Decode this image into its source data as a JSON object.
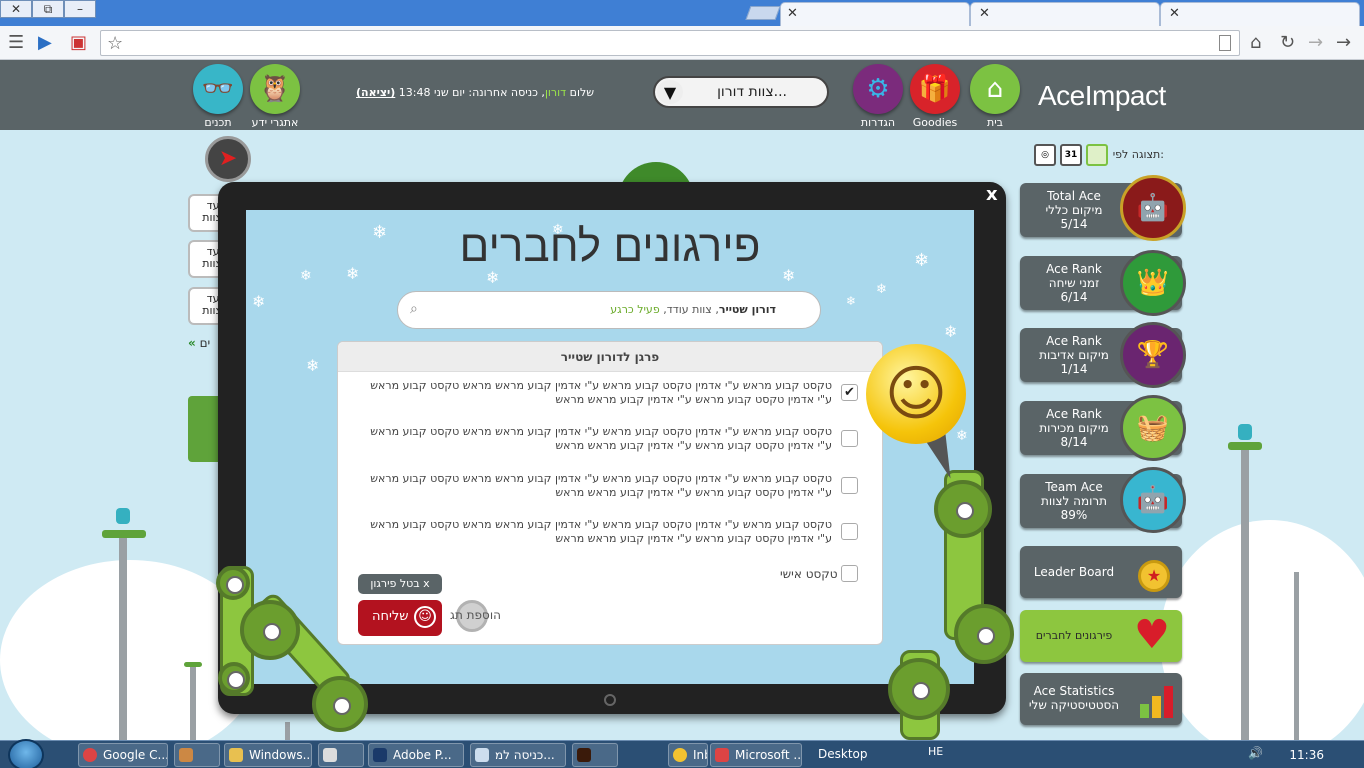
{
  "browser": {
    "window_buttons": [
      "✕",
      "⧉",
      "–"
    ],
    "tabs": [
      {
        "label": "",
        "close": "✕"
      },
      {
        "label": "",
        "close": "✕"
      },
      {
        "label": "",
        "close": "✕"
      }
    ]
  },
  "app": {
    "logo": "AceImpact",
    "nav": {
      "home": "בית",
      "goodies": "Goodies",
      "settings": "הגדרות",
      "challenges": "אתגרי ידע",
      "content": "תכנים"
    },
    "team_select": "צוות דורון...",
    "greeting": {
      "hello": "שלום",
      "user": "דורון",
      "last_login": ", כניסה אחרונה: יום שני 13:48",
      "exit": "(יציאה)"
    },
    "view_by": "תצוגה לפי:",
    "calendar_day": "31"
  },
  "sidebar": [
    {
      "line1": "Total Ace",
      "line2": "מיקום כללי",
      "line3": "5/14"
    },
    {
      "line1": "Ace Rank",
      "line2": "זמני שיחה",
      "line3": "6/14"
    },
    {
      "line1": "Ace Rank",
      "line2": "מיקום אדיבות",
      "line3": "1/14"
    },
    {
      "line1": "Ace Rank",
      "line2": "מיקום מכירות",
      "line3": "8/14"
    },
    {
      "line1": "Team Ace",
      "line2": "תרומה לצוות",
      "line3": "89%"
    },
    {
      "line1": "Leader Board"
    },
    {
      "line1": "פירגונים לחברים"
    },
    {
      "line1": "Ace Statistics",
      "line2": "הסטטיסטיקה שלי"
    }
  ],
  "left_cards": [
    "יעד\nצוות",
    "יעד\nצוות",
    "יעד\nצוות"
  ],
  "left_more": "ים",
  "modal": {
    "close": "x",
    "title": "פירגונים לחברים",
    "search": {
      "name": "דורון שטייר",
      "team": ", צוות עודד, ",
      "status": "פעיל כרגע"
    },
    "panel_title": "פרגן לדורון שטייר",
    "options": [
      {
        "text": "טקסט קבוע מראש ע\"י אדמין טקסט קבוע מראש ע\"י אדמין קבוע מראש מראש טקסט קבוע מראש ע\"י אדמין טקסט קבוע מראש ע\"י אדמין קבוע מראש מראש",
        "checked": true
      },
      {
        "text": "טקסט קבוע מראש ע\"י אדמין טקסט קבוע מראש ע\"י אדמין קבוע מראש מראש טקסט קבוע מראש ע\"י אדמין טקסט קבוע מראש ע\"י אדמין קבוע מראש מראש",
        "checked": false
      },
      {
        "text": "טקסט קבוע מראש ע\"י אדמין טקסט קבוע מראש ע\"י אדמין קבוע מראש מראש טקסט קבוע מראש ע\"י אדמין טקסט קבוע מראש ע\"י אדמין קבוע מראש מראש",
        "checked": false
      },
      {
        "text": "טקסט קבוע מראש ע\"י אדמין טקסט קבוע מראש ע\"י אדמין קבוע מראש מראש טקסט קבוע מראש ע\"י אדמין טקסט קבוע מראש ע\"י אדמין קבוע מראש מראש",
        "checked": false
      }
    ],
    "personal_text": "טקסט אישי",
    "cancel": "x בטל פירגון",
    "send": "שליחה",
    "add_tag": "הוספת תג"
  },
  "taskbar": {
    "items": [
      "Google C...",
      "",
      "Windows...",
      "",
      "Adobe P...",
      "כניסה למ...",
      "",
      "Inb",
      "Microsoft ..."
    ],
    "desktop": "Desktop",
    "lang": "HE",
    "clock": "11:36"
  },
  "colors": {
    "header": "#5a6467",
    "accent_green": "#8dc63f",
    "send_red": "#b3121f",
    "sky": "#cfeaf3"
  }
}
